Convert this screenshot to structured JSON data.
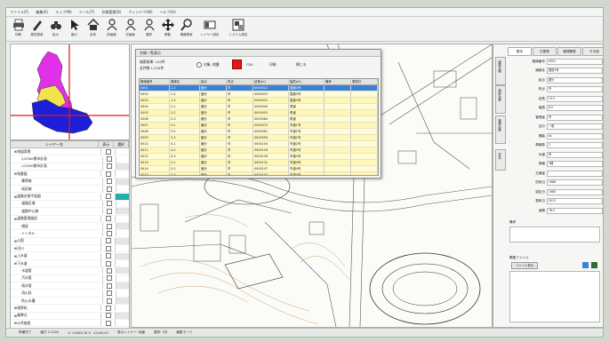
{
  "menu": [
    "ファイル(F)",
    "編集(E)",
    "マップ(M)",
    "ツール(T)",
    "台帳管理(D)",
    "ウィンドウ(W)",
    "ヘルプ(H)"
  ],
  "toolbar": [
    {
      "label": "印刷",
      "icon": "printer-icon"
    },
    {
      "label": "属性検索",
      "icon": "pen-icon"
    },
    {
      "label": "拡大",
      "icon": "binoculars-icon"
    },
    {
      "label": "縮小",
      "icon": "pointer-icon"
    },
    {
      "label": "全体",
      "icon": "home-icon"
    },
    {
      "label": "前画面",
      "icon": "person-icon"
    },
    {
      "label": "次画面",
      "icon": "person-icon"
    },
    {
      "label": "選択",
      "icon": "person-icon"
    },
    {
      "label": "移動",
      "icon": "move-icon"
    },
    {
      "label": "情報検索",
      "icon": "search-icon"
    },
    {
      "label": "レイヤー設定",
      "icon": "layer-icon"
    },
    {
      "label": "システム設定",
      "icon": "settings-icon"
    }
  ],
  "layer_panel": {
    "headers": [
      "レイヤー名",
      "表示",
      "選択"
    ],
    "rows": [
      {
        "name": "地図背景",
        "level": 0
      },
      {
        "name": "1/2500都市計画",
        "level": 1
      },
      {
        "name": "1/1000都市計画",
        "level": 1
      },
      {
        "name": "地番図",
        "level": 0
      },
      {
        "name": "筆界線",
        "level": 1
      },
      {
        "name": "街区線",
        "level": 1
      },
      {
        "name": "道路台帳平面図",
        "level": 0
      },
      {
        "name": "道路区域",
        "level": 1
      },
      {
        "name": "道路中心線",
        "level": 1
      },
      {
        "name": "道路管理施設",
        "level": 0
      },
      {
        "name": "橋梁",
        "level": 1
      },
      {
        "name": "トンネル",
        "level": 1
      },
      {
        "name": "公園",
        "level": 0
      },
      {
        "name": "河川",
        "level": 0
      },
      {
        "name": "上水道",
        "level": 0
      },
      {
        "name": "下水道",
        "level": 0
      },
      {
        "name": "水道管",
        "level": 1
      },
      {
        "name": "汚水管",
        "level": 1
      },
      {
        "name": "雨水管",
        "level": 1
      },
      {
        "name": "消火栓",
        "level": 1
      },
      {
        "name": "防火水槽",
        "level": 1
      },
      {
        "name": "境界杭",
        "level": 0
      },
      {
        "name": "基準点",
        "level": 0
      },
      {
        "name": "公共施設",
        "level": 0
      },
      {
        "name": "学校",
        "level": 1
      },
      {
        "name": "地区界",
        "level": 0
      },
      {
        "name": "行政界",
        "level": 0
      },
      {
        "name": "航空写真",
        "level": 0
      }
    ]
  },
  "dialog": {
    "title": "台帳一覧表示",
    "info_line1": "検索結果: 120件",
    "info_line2": "全件数 1,234件",
    "radio_label": "対象: 地番",
    "buttons": [
      "CSV",
      "印刷",
      "閉じる"
    ],
    "columns": [
      "路線番号",
      "路線名",
      "起点",
      "終点",
      "延長(m)",
      "幅員(m)",
      "備考",
      "更新日"
    ],
    "rows": [
      [
        "0001",
        "1-1",
        "國分",
        "市",
        "0000012",
        "国道3号",
        "",
        ""
      ],
      [
        "0002",
        "1-2",
        "國分",
        "市",
        "0000023",
        "国道3号",
        "",
        ""
      ],
      [
        "0003",
        "1-3",
        "國分",
        "市",
        "0000031",
        "国道3号",
        "",
        ""
      ],
      [
        "0004",
        "2-1",
        "國分",
        "市",
        "0000045",
        "県道",
        "",
        ""
      ],
      [
        "0005",
        "2-2",
        "國分",
        "市",
        "0000052",
        "県道",
        "",
        ""
      ],
      [
        "0006",
        "2-3",
        "國分",
        "市",
        "0000064",
        "県道",
        "",
        ""
      ],
      [
        "0007",
        "3-1",
        "國分",
        "市",
        "0000075",
        "市道1号",
        "",
        ""
      ],
      [
        "0008",
        "3-2",
        "國分",
        "市",
        "0000081",
        "市道1号",
        "",
        ""
      ],
      [
        "0009",
        "3-3",
        "國分",
        "市",
        "0000093",
        "市道2号",
        "",
        ""
      ],
      [
        "0010",
        "4-1",
        "國分",
        "市",
        "0000104",
        "市道2号",
        "",
        ""
      ],
      [
        "0011",
        "4-2",
        "國分",
        "市",
        "0000116",
        "市道3号",
        "",
        ""
      ],
      [
        "0012",
        "4-3",
        "國分",
        "市",
        "0000128",
        "市道3号",
        "",
        ""
      ],
      [
        "0013",
        "5-1",
        "國分",
        "市",
        "0000132",
        "市道4号",
        "",
        ""
      ],
      [
        "0014",
        "5-2",
        "國分",
        "市",
        "0000147",
        "市道4号",
        "",
        ""
      ],
      [
        "0015",
        "5-3",
        "國分",
        "市",
        "0000155",
        "市道5号",
        "",
        ""
      ],
      [
        "0016",
        "6-1",
        "國分",
        "市",
        "0000163",
        "市道5号",
        "",
        ""
      ],
      [
        "0017",
        "6-2",
        "國分",
        "市",
        "0000178",
        "市道6号",
        "",
        ""
      ]
    ]
  },
  "right_panel": {
    "tabs": [
      "基本",
      "付属物",
      "管理履歴",
      "その他"
    ],
    "side_tabs": [
      "道路台帳",
      "施設台帳",
      "管理台帳",
      "写真"
    ],
    "fields": [
      {
        "label": "路線番号",
        "value": "0001"
      },
      {
        "label": "路線名",
        "value": "国道3号"
      },
      {
        "label": "起点",
        "value": "國分"
      },
      {
        "label": "終点",
        "value": "市"
      },
      {
        "label": "延長",
        "value": "12.0"
      },
      {
        "label": "幅員",
        "value": "6.5"
      },
      {
        "label": "管理者",
        "value": "市"
      },
      {
        "label": "区分",
        "value": "一般"
      },
      {
        "label": "舗装",
        "value": "As"
      },
      {
        "label": "車線数",
        "value": "2"
      },
      {
        "label": "歩道",
        "value": "有"
      },
      {
        "label": "規格",
        "value": "3種"
      },
      {
        "label": "交通量",
        "value": "-"
      },
      {
        "label": "供用日",
        "value": "1988"
      },
      {
        "label": "認定日",
        "value": "1985"
      },
      {
        "label": "更新日",
        "value": "2013"
      },
      {
        "label": "面積",
        "value": "78.0"
      }
    ],
    "memo_label": "備考",
    "attach_label": "関連ファイル",
    "attach_button": "ファイル表示"
  },
  "status": [
    "準備完了",
    "縮尺 1:2500",
    "X: 23456.78  Y: -12345.67",
    "表示レイヤー: 地番",
    "選択: 1件",
    "編集モード"
  ],
  "colors": {
    "selection": "#3b82d6",
    "grid_yellow": "#fff7b8",
    "overview_magenta": "#e030e8",
    "overview_yellow": "#f1e34a",
    "overview_blue": "#1d1fd8"
  }
}
